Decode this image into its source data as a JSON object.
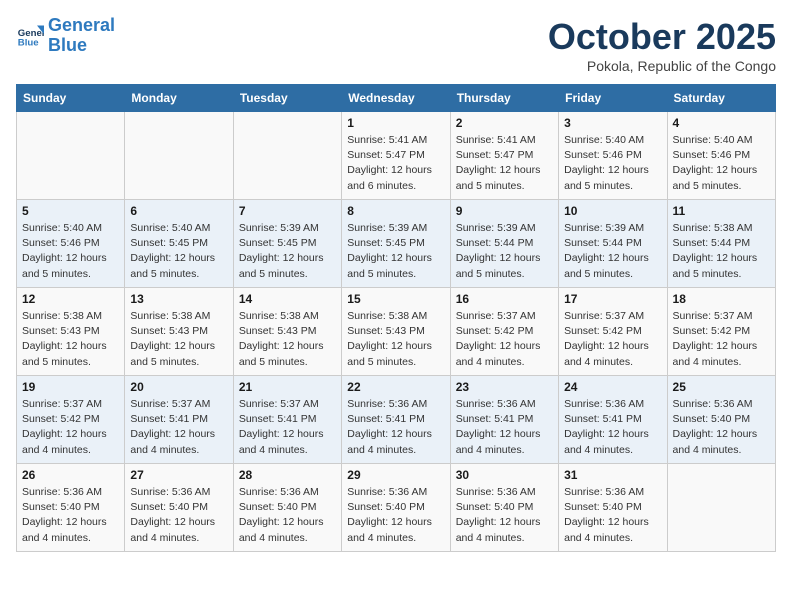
{
  "header": {
    "logo_general": "General",
    "logo_blue": "Blue",
    "month": "October 2025",
    "location": "Pokola, Republic of the Congo"
  },
  "days_of_week": [
    "Sunday",
    "Monday",
    "Tuesday",
    "Wednesday",
    "Thursday",
    "Friday",
    "Saturday"
  ],
  "weeks": [
    [
      {
        "day": "",
        "info": ""
      },
      {
        "day": "",
        "info": ""
      },
      {
        "day": "",
        "info": ""
      },
      {
        "day": "1",
        "info": "Sunrise: 5:41 AM\nSunset: 5:47 PM\nDaylight: 12 hours\nand 6 minutes."
      },
      {
        "day": "2",
        "info": "Sunrise: 5:41 AM\nSunset: 5:47 PM\nDaylight: 12 hours\nand 5 minutes."
      },
      {
        "day": "3",
        "info": "Sunrise: 5:40 AM\nSunset: 5:46 PM\nDaylight: 12 hours\nand 5 minutes."
      },
      {
        "day": "4",
        "info": "Sunrise: 5:40 AM\nSunset: 5:46 PM\nDaylight: 12 hours\nand 5 minutes."
      }
    ],
    [
      {
        "day": "5",
        "info": "Sunrise: 5:40 AM\nSunset: 5:46 PM\nDaylight: 12 hours\nand 5 minutes."
      },
      {
        "day": "6",
        "info": "Sunrise: 5:40 AM\nSunset: 5:45 PM\nDaylight: 12 hours\nand 5 minutes."
      },
      {
        "day": "7",
        "info": "Sunrise: 5:39 AM\nSunset: 5:45 PM\nDaylight: 12 hours\nand 5 minutes."
      },
      {
        "day": "8",
        "info": "Sunrise: 5:39 AM\nSunset: 5:45 PM\nDaylight: 12 hours\nand 5 minutes."
      },
      {
        "day": "9",
        "info": "Sunrise: 5:39 AM\nSunset: 5:44 PM\nDaylight: 12 hours\nand 5 minutes."
      },
      {
        "day": "10",
        "info": "Sunrise: 5:39 AM\nSunset: 5:44 PM\nDaylight: 12 hours\nand 5 minutes."
      },
      {
        "day": "11",
        "info": "Sunrise: 5:38 AM\nSunset: 5:44 PM\nDaylight: 12 hours\nand 5 minutes."
      }
    ],
    [
      {
        "day": "12",
        "info": "Sunrise: 5:38 AM\nSunset: 5:43 PM\nDaylight: 12 hours\nand 5 minutes."
      },
      {
        "day": "13",
        "info": "Sunrise: 5:38 AM\nSunset: 5:43 PM\nDaylight: 12 hours\nand 5 minutes."
      },
      {
        "day": "14",
        "info": "Sunrise: 5:38 AM\nSunset: 5:43 PM\nDaylight: 12 hours\nand 5 minutes."
      },
      {
        "day": "15",
        "info": "Sunrise: 5:38 AM\nSunset: 5:43 PM\nDaylight: 12 hours\nand 5 minutes."
      },
      {
        "day": "16",
        "info": "Sunrise: 5:37 AM\nSunset: 5:42 PM\nDaylight: 12 hours\nand 4 minutes."
      },
      {
        "day": "17",
        "info": "Sunrise: 5:37 AM\nSunset: 5:42 PM\nDaylight: 12 hours\nand 4 minutes."
      },
      {
        "day": "18",
        "info": "Sunrise: 5:37 AM\nSunset: 5:42 PM\nDaylight: 12 hours\nand 4 minutes."
      }
    ],
    [
      {
        "day": "19",
        "info": "Sunrise: 5:37 AM\nSunset: 5:42 PM\nDaylight: 12 hours\nand 4 minutes."
      },
      {
        "day": "20",
        "info": "Sunrise: 5:37 AM\nSunset: 5:41 PM\nDaylight: 12 hours\nand 4 minutes."
      },
      {
        "day": "21",
        "info": "Sunrise: 5:37 AM\nSunset: 5:41 PM\nDaylight: 12 hours\nand 4 minutes."
      },
      {
        "day": "22",
        "info": "Sunrise: 5:36 AM\nSunset: 5:41 PM\nDaylight: 12 hours\nand 4 minutes."
      },
      {
        "day": "23",
        "info": "Sunrise: 5:36 AM\nSunset: 5:41 PM\nDaylight: 12 hours\nand 4 minutes."
      },
      {
        "day": "24",
        "info": "Sunrise: 5:36 AM\nSunset: 5:41 PM\nDaylight: 12 hours\nand 4 minutes."
      },
      {
        "day": "25",
        "info": "Sunrise: 5:36 AM\nSunset: 5:40 PM\nDaylight: 12 hours\nand 4 minutes."
      }
    ],
    [
      {
        "day": "26",
        "info": "Sunrise: 5:36 AM\nSunset: 5:40 PM\nDaylight: 12 hours\nand 4 minutes."
      },
      {
        "day": "27",
        "info": "Sunrise: 5:36 AM\nSunset: 5:40 PM\nDaylight: 12 hours\nand 4 minutes."
      },
      {
        "day": "28",
        "info": "Sunrise: 5:36 AM\nSunset: 5:40 PM\nDaylight: 12 hours\nand 4 minutes."
      },
      {
        "day": "29",
        "info": "Sunrise: 5:36 AM\nSunset: 5:40 PM\nDaylight: 12 hours\nand 4 minutes."
      },
      {
        "day": "30",
        "info": "Sunrise: 5:36 AM\nSunset: 5:40 PM\nDaylight: 12 hours\nand 4 minutes."
      },
      {
        "day": "31",
        "info": "Sunrise: 5:36 AM\nSunset: 5:40 PM\nDaylight: 12 hours\nand 4 minutes."
      },
      {
        "day": "",
        "info": ""
      }
    ]
  ]
}
